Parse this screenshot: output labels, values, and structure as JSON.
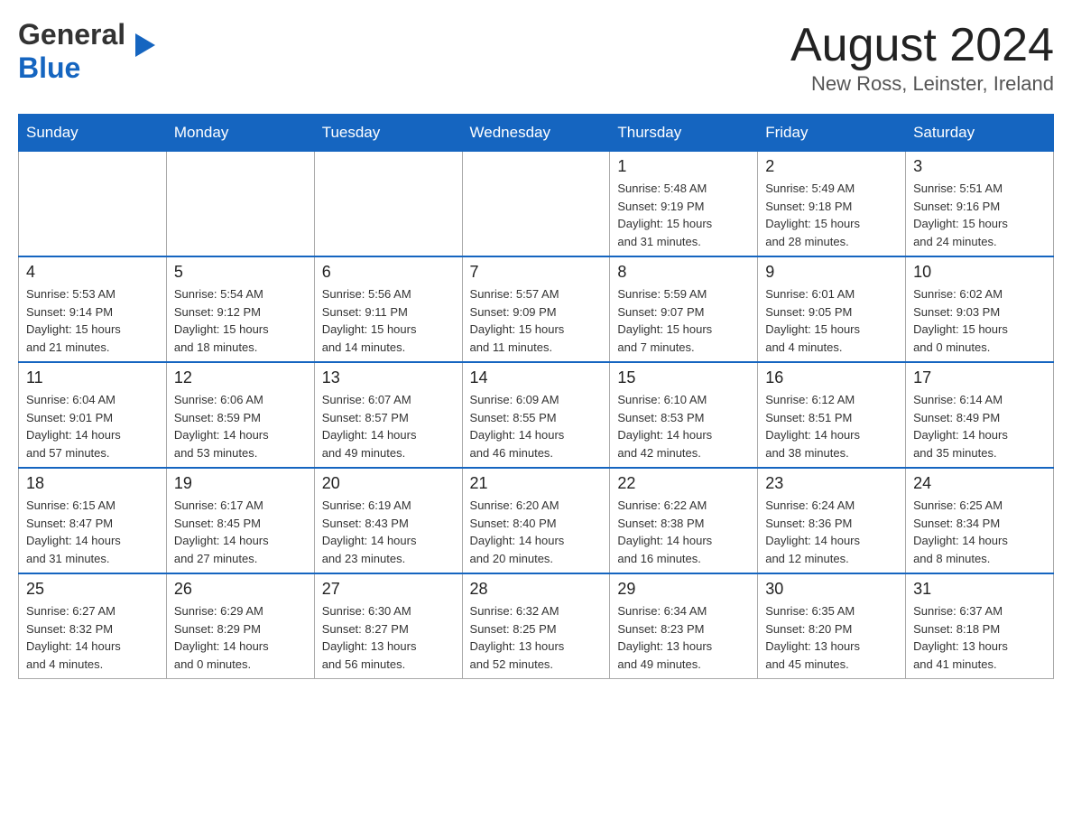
{
  "header": {
    "logo_general": "General",
    "logo_blue": "Blue",
    "month": "August 2024",
    "location": "New Ross, Leinster, Ireland"
  },
  "days_of_week": [
    "Sunday",
    "Monday",
    "Tuesday",
    "Wednesday",
    "Thursday",
    "Friday",
    "Saturday"
  ],
  "weeks": [
    [
      {
        "day": "",
        "info": ""
      },
      {
        "day": "",
        "info": ""
      },
      {
        "day": "",
        "info": ""
      },
      {
        "day": "",
        "info": ""
      },
      {
        "day": "1",
        "info": "Sunrise: 5:48 AM\nSunset: 9:19 PM\nDaylight: 15 hours\nand 31 minutes."
      },
      {
        "day": "2",
        "info": "Sunrise: 5:49 AM\nSunset: 9:18 PM\nDaylight: 15 hours\nand 28 minutes."
      },
      {
        "day": "3",
        "info": "Sunrise: 5:51 AM\nSunset: 9:16 PM\nDaylight: 15 hours\nand 24 minutes."
      }
    ],
    [
      {
        "day": "4",
        "info": "Sunrise: 5:53 AM\nSunset: 9:14 PM\nDaylight: 15 hours\nand 21 minutes."
      },
      {
        "day": "5",
        "info": "Sunrise: 5:54 AM\nSunset: 9:12 PM\nDaylight: 15 hours\nand 18 minutes."
      },
      {
        "day": "6",
        "info": "Sunrise: 5:56 AM\nSunset: 9:11 PM\nDaylight: 15 hours\nand 14 minutes."
      },
      {
        "day": "7",
        "info": "Sunrise: 5:57 AM\nSunset: 9:09 PM\nDaylight: 15 hours\nand 11 minutes."
      },
      {
        "day": "8",
        "info": "Sunrise: 5:59 AM\nSunset: 9:07 PM\nDaylight: 15 hours\nand 7 minutes."
      },
      {
        "day": "9",
        "info": "Sunrise: 6:01 AM\nSunset: 9:05 PM\nDaylight: 15 hours\nand 4 minutes."
      },
      {
        "day": "10",
        "info": "Sunrise: 6:02 AM\nSunset: 9:03 PM\nDaylight: 15 hours\nand 0 minutes."
      }
    ],
    [
      {
        "day": "11",
        "info": "Sunrise: 6:04 AM\nSunset: 9:01 PM\nDaylight: 14 hours\nand 57 minutes."
      },
      {
        "day": "12",
        "info": "Sunrise: 6:06 AM\nSunset: 8:59 PM\nDaylight: 14 hours\nand 53 minutes."
      },
      {
        "day": "13",
        "info": "Sunrise: 6:07 AM\nSunset: 8:57 PM\nDaylight: 14 hours\nand 49 minutes."
      },
      {
        "day": "14",
        "info": "Sunrise: 6:09 AM\nSunset: 8:55 PM\nDaylight: 14 hours\nand 46 minutes."
      },
      {
        "day": "15",
        "info": "Sunrise: 6:10 AM\nSunset: 8:53 PM\nDaylight: 14 hours\nand 42 minutes."
      },
      {
        "day": "16",
        "info": "Sunrise: 6:12 AM\nSunset: 8:51 PM\nDaylight: 14 hours\nand 38 minutes."
      },
      {
        "day": "17",
        "info": "Sunrise: 6:14 AM\nSunset: 8:49 PM\nDaylight: 14 hours\nand 35 minutes."
      }
    ],
    [
      {
        "day": "18",
        "info": "Sunrise: 6:15 AM\nSunset: 8:47 PM\nDaylight: 14 hours\nand 31 minutes."
      },
      {
        "day": "19",
        "info": "Sunrise: 6:17 AM\nSunset: 8:45 PM\nDaylight: 14 hours\nand 27 minutes."
      },
      {
        "day": "20",
        "info": "Sunrise: 6:19 AM\nSunset: 8:43 PM\nDaylight: 14 hours\nand 23 minutes."
      },
      {
        "day": "21",
        "info": "Sunrise: 6:20 AM\nSunset: 8:40 PM\nDaylight: 14 hours\nand 20 minutes."
      },
      {
        "day": "22",
        "info": "Sunrise: 6:22 AM\nSunset: 8:38 PM\nDaylight: 14 hours\nand 16 minutes."
      },
      {
        "day": "23",
        "info": "Sunrise: 6:24 AM\nSunset: 8:36 PM\nDaylight: 14 hours\nand 12 minutes."
      },
      {
        "day": "24",
        "info": "Sunrise: 6:25 AM\nSunset: 8:34 PM\nDaylight: 14 hours\nand 8 minutes."
      }
    ],
    [
      {
        "day": "25",
        "info": "Sunrise: 6:27 AM\nSunset: 8:32 PM\nDaylight: 14 hours\nand 4 minutes."
      },
      {
        "day": "26",
        "info": "Sunrise: 6:29 AM\nSunset: 8:29 PM\nDaylight: 14 hours\nand 0 minutes."
      },
      {
        "day": "27",
        "info": "Sunrise: 6:30 AM\nSunset: 8:27 PM\nDaylight: 13 hours\nand 56 minutes."
      },
      {
        "day": "28",
        "info": "Sunrise: 6:32 AM\nSunset: 8:25 PM\nDaylight: 13 hours\nand 52 minutes."
      },
      {
        "day": "29",
        "info": "Sunrise: 6:34 AM\nSunset: 8:23 PM\nDaylight: 13 hours\nand 49 minutes."
      },
      {
        "day": "30",
        "info": "Sunrise: 6:35 AM\nSunset: 8:20 PM\nDaylight: 13 hours\nand 45 minutes."
      },
      {
        "day": "31",
        "info": "Sunrise: 6:37 AM\nSunset: 8:18 PM\nDaylight: 13 hours\nand 41 minutes."
      }
    ]
  ]
}
